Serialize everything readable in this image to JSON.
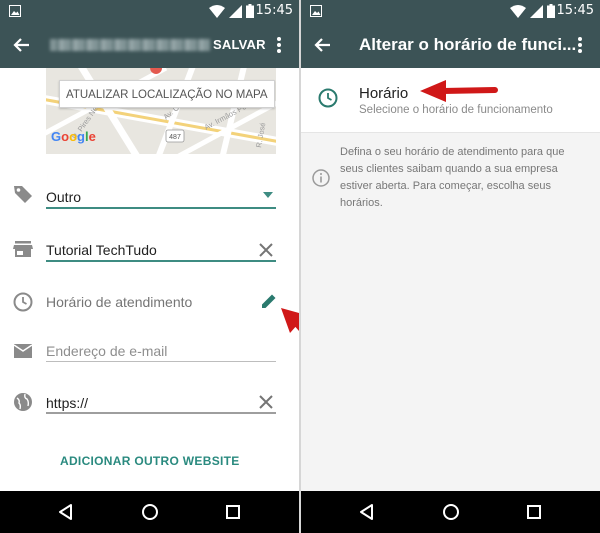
{
  "status_bar": {
    "time": "15:45",
    "colors": {
      "bar": "#3c5356"
    }
  },
  "left_screen": {
    "header": {
      "save_label": "SALVAR",
      "back_icon": "arrow-back-icon",
      "more_icon": "more-vert-icon"
    },
    "map": {
      "update_button": "ATUALIZAR LOCALIZAÇÃO NO MAPA",
      "logo": "Google",
      "road_badge": "487"
    },
    "fields": {
      "category": {
        "value": "Outro",
        "icon": "tag-icon"
      },
      "business_name": {
        "value": "Tutorial TechTudo",
        "icon": "store-icon"
      },
      "hours": {
        "label": "Horário de atendimento",
        "icon": "clock-icon",
        "action_icon": "edit-pencil-icon"
      },
      "email": {
        "placeholder": "Endereço de e-mail",
        "icon": "email-icon"
      },
      "website": {
        "value": "https://",
        "icon": "globe-icon"
      }
    },
    "add_website_label": "ADICIONAR OUTRO WEBSITE"
  },
  "right_screen": {
    "header": {
      "title": "Alterar o horário de funci..."
    },
    "hours_item": {
      "title": "Horário",
      "subtitle": "Selecione o horário de funcionamento"
    },
    "info_text": "Defina o seu horário de atendimento para que seus clientes saibam quando a sua empresa estiver aberta. Para começar, escolha seus horários."
  },
  "theme": {
    "accent": "#2a8a7f",
    "annotation_arrow": "#d01818"
  }
}
